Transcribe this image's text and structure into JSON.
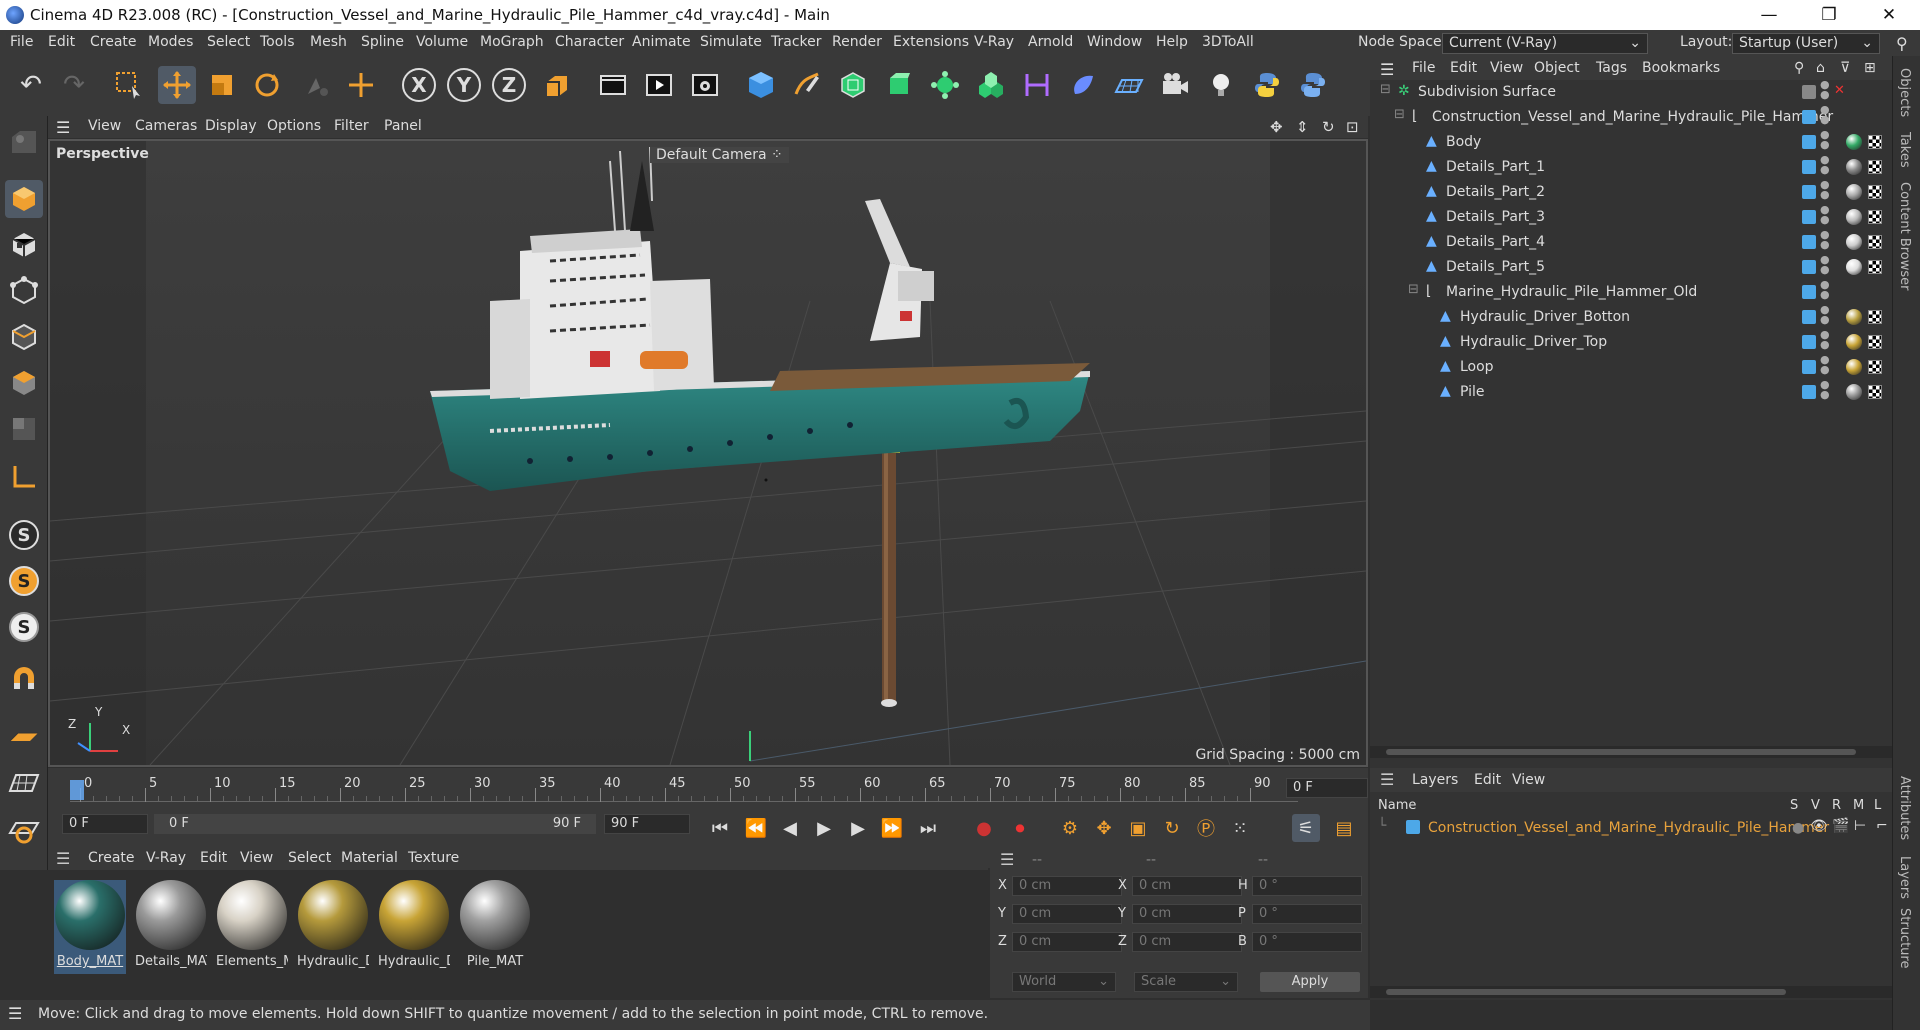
{
  "window": {
    "title": "Cinema 4D R23.008 (RC) - [Construction_Vessel_and_Marine_Hydraulic_Pile_Hammer_c4d_vray.c4d] - Main",
    "controls": [
      "—",
      "❐",
      "✕"
    ]
  },
  "menu": [
    "File",
    "Edit",
    "Create",
    "Modes",
    "Select",
    "Tools",
    "Mesh",
    "Spline",
    "Volume",
    "MoGraph",
    "Character",
    "Animate",
    "Simulate",
    "Tracker",
    "Render",
    "Extensions",
    "V-Ray",
    "Arnold",
    "Window",
    "Help",
    "3DToAll"
  ],
  "node_space": {
    "label": "Node Space:",
    "value": "Current (V-Ray)"
  },
  "layout": {
    "label": "Layout:",
    "value": "Startup (User)"
  },
  "viewport": {
    "menu": [
      "View",
      "Cameras",
      "Display",
      "Options",
      "Filter",
      "Panel"
    ],
    "name": "Perspective",
    "camera": "Default Camera",
    "grid_spacing": "Grid Spacing : 5000 cm"
  },
  "timeline": {
    "ticks": [
      "0",
      "5",
      "10",
      "15",
      "20",
      "25",
      "30",
      "35",
      "40",
      "45",
      "50",
      "55",
      "60",
      "65",
      "70",
      "75",
      "80",
      "85",
      "90"
    ],
    "current_frame": "0 F",
    "start": "0 F",
    "range_start": "0 F",
    "range_end": "90 F",
    "end": "90 F"
  },
  "material_manager": {
    "menu": [
      "Create",
      "V-Ray",
      "Edit",
      "View",
      "Select",
      "Material",
      "Texture"
    ],
    "materials": [
      {
        "name": "Body_MAT",
        "color": "#2a6f6a"
      },
      {
        "name": "Details_MAT",
        "color": "#9a9a9a"
      },
      {
        "name": "Elements_M",
        "color": "#d8d2c6"
      },
      {
        "name": "Hydraulic_D",
        "color": "#b59a3c"
      },
      {
        "name": "Hydraulic_D",
        "color": "#c8a436"
      },
      {
        "name": "Pile_MAT",
        "color": "#a0a0a0"
      }
    ]
  },
  "coordinates": {
    "headers": [
      "--",
      "--",
      "--"
    ],
    "rows": [
      {
        "a": "X",
        "av": "0 cm",
        "b": "X",
        "bv": "0 cm",
        "c": "H",
        "cv": "0 °"
      },
      {
        "a": "Y",
        "av": "0 cm",
        "b": "Y",
        "bv": "0 cm",
        "c": "P",
        "cv": "0 °"
      },
      {
        "a": "Z",
        "av": "0 cm",
        "b": "Z",
        "bv": "0 cm",
        "c": "B",
        "cv": "0 °"
      }
    ],
    "mode": "World",
    "type": "Scale",
    "apply": "Apply"
  },
  "status": "Move: Click and drag to move elements. Hold down SHIFT to quantize movement / add to the selection in point mode, CTRL to remove.",
  "object_manager": {
    "menu": [
      "File",
      "Edit",
      "View",
      "Object",
      "Tags",
      "Bookmarks"
    ],
    "objects": [
      {
        "name": "Subdivision Surface",
        "depth": 0
      },
      {
        "name": "Construction_Vessel_and_Marine_Hydraulic_Pile_Hammer",
        "depth": 1
      },
      {
        "name": "Body",
        "depth": 2
      },
      {
        "name": "Details_Part_1",
        "depth": 2
      },
      {
        "name": "Details_Part_2",
        "depth": 2
      },
      {
        "name": "Details_Part_3",
        "depth": 2
      },
      {
        "name": "Details_Part_4",
        "depth": 2
      },
      {
        "name": "Details_Part_5",
        "depth": 2
      },
      {
        "name": "Marine_Hydraulic_Pile_Hammer_Old",
        "depth": 2
      },
      {
        "name": "Hydraulic_Driver_Botton",
        "depth": 3
      },
      {
        "name": "Hydraulic_Driver_Top",
        "depth": 3
      },
      {
        "name": "Loop",
        "depth": 3
      },
      {
        "name": "Pile",
        "depth": 3
      }
    ]
  },
  "layer_manager": {
    "menu": [
      "Layers",
      "Edit",
      "View"
    ],
    "col_name": "Name",
    "cols": [
      "S",
      "V",
      "R",
      "M",
      "L"
    ],
    "layer": "Construction_Vessel_and_Marine_Hydraulic_Pile_Hammer",
    "layer_color": "#e8a23c"
  },
  "side_tabs": [
    "Objects",
    "Takes",
    "Content Browser",
    "Attributes",
    "Layers",
    "Structure"
  ]
}
